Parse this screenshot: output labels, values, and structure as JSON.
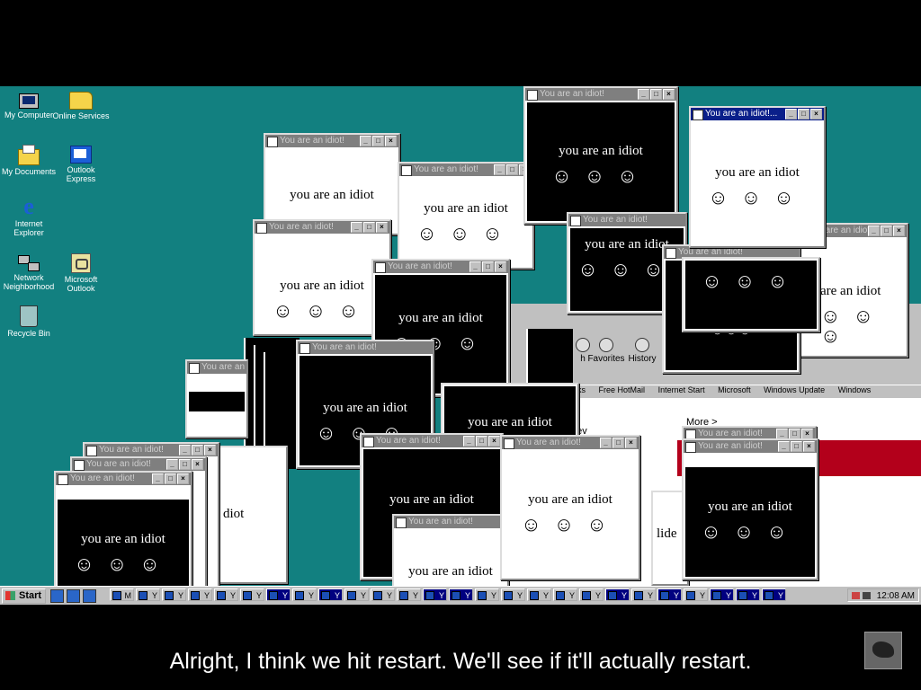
{
  "desktop": {
    "icons": [
      {
        "label": "My Computer",
        "icon": "my-computer-icon"
      },
      {
        "label": "Online Services",
        "icon": "folder-icon"
      },
      {
        "label": "My Documents",
        "icon": "my-documents-icon"
      },
      {
        "label": "Outlook Express",
        "icon": "outlook-express-icon"
      },
      {
        "label": "Internet Explorer",
        "icon": "internet-explorer-icon"
      },
      {
        "label": "Network Neighborhood",
        "icon": "network-icon"
      },
      {
        "label": "Microsoft Outlook",
        "icon": "outlook-icon"
      },
      {
        "label": "Recycle Bin",
        "icon": "recycle-bin-icon"
      }
    ],
    "background_color": "#128080"
  },
  "popup": {
    "title": "You are an idiot!",
    "title_short": "You are an idiot!...",
    "message": "you are an idiot",
    "smileys": "☺☺☺",
    "btn_min": "_",
    "btn_max": "□",
    "btn_close": "×"
  },
  "partial_texts": {
    "you": "yo",
    "diot": "diot",
    "are_an_idiot": "are an idiot",
    "idiot_fragment": "idiot",
    "lide": "lide",
    "t": "t"
  },
  "browser": {
    "toolbar": {
      "favorites": "Favorites",
      "history": "History",
      "search_fragment": "h"
    },
    "links": [
      "inks",
      "Free HotMail",
      "Internet Start",
      "Microsoft",
      "Windows Update",
      "Windows"
    ],
    "more_link": "More >",
    "fragment_dev": "dev"
  },
  "taskbar": {
    "start_label": "Start",
    "task_label": "Y",
    "first_task_label": "M",
    "clock": "12:08 AM",
    "task_count": 26
  },
  "caption": {
    "text": "Alright, I think we hit restart. We'll see if it'll actually restart."
  }
}
